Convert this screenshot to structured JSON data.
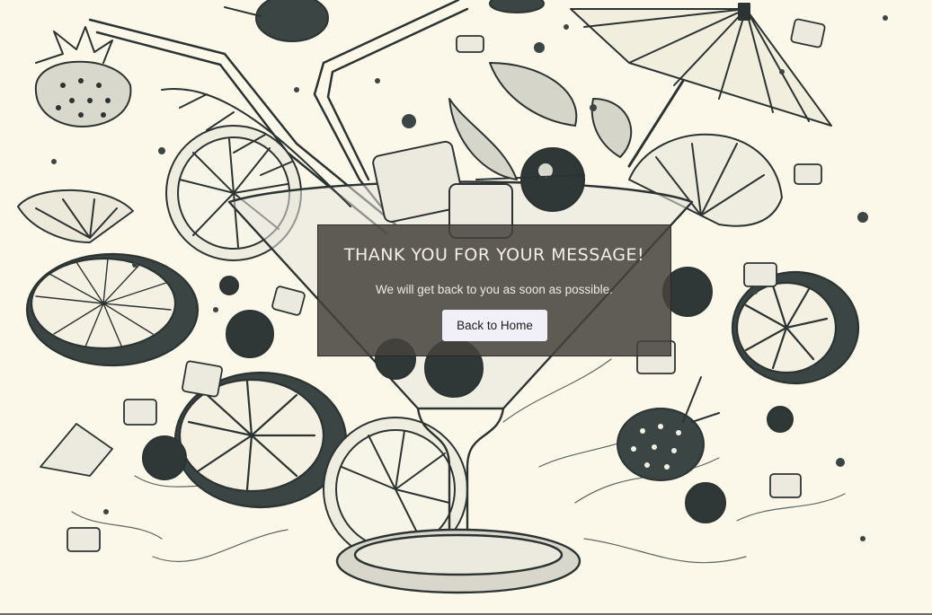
{
  "modal": {
    "title": "THANK YOU FOR YOUR MESSAGE!",
    "message": "We will get back to you as soon as possible.",
    "button_label": "Back to Home"
  },
  "colors": {
    "background": "#fbf8ea",
    "ink": "#2c3433",
    "overlay": "#46423e",
    "button": "#f1f0f8"
  }
}
